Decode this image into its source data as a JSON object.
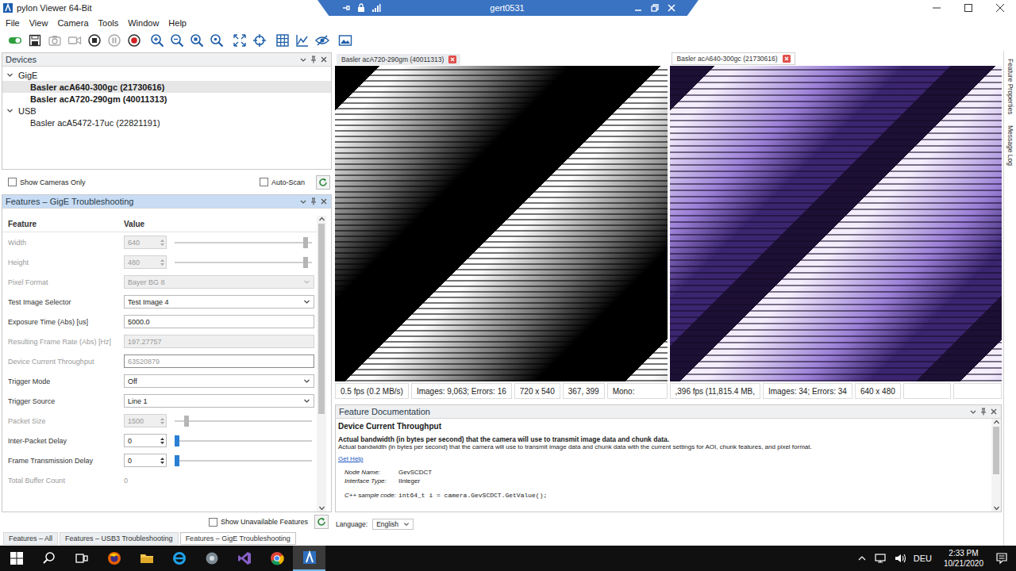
{
  "window": {
    "title": "pylon Viewer 64-Bit"
  },
  "remote_bar": {
    "title": "gert0531"
  },
  "menu": [
    "File",
    "View",
    "Camera",
    "Tools",
    "Window",
    "Help"
  ],
  "toolbar": [
    {
      "kind": "open",
      "disabled": false
    },
    {
      "kind": "save",
      "disabled": false
    },
    {
      "kind": "snapshot",
      "disabled": true
    },
    {
      "kind": "video",
      "disabled": true
    },
    {
      "kind": "stop",
      "disabled": false
    },
    {
      "kind": "pause",
      "disabled": true
    },
    {
      "kind": "record",
      "disabled": false
    },
    {
      "kind": "zoom-in",
      "disabled": false
    },
    {
      "kind": "zoom-out",
      "disabled": false
    },
    {
      "kind": "zoom-reset",
      "disabled": false
    },
    {
      "kind": "zoom-fit",
      "disabled": false
    },
    {
      "kind": "fit-window",
      "disabled": false
    },
    {
      "kind": "crosshair",
      "disabled": false
    },
    {
      "kind": "grid",
      "disabled": false
    },
    {
      "kind": "histogram",
      "disabled": false
    },
    {
      "kind": "hide",
      "disabled": false
    },
    {
      "kind": "image",
      "disabled": false
    }
  ],
  "devices": {
    "title": "Devices",
    "groups": [
      {
        "label": "GigE",
        "expanded": true,
        "items": [
          {
            "label": "Basler acA640-300gc (21730616)",
            "bold": true,
            "selected": true
          },
          {
            "label": "Basler acA720-290gm (40011313)",
            "bold": true,
            "selected": false
          }
        ]
      },
      {
        "label": "USB",
        "expanded": true,
        "items": [
          {
            "label": "Basler acA5472-17uc (22821191)",
            "bold": false,
            "selected": false
          }
        ]
      }
    ]
  },
  "show_cameras_only": {
    "label": "Show Cameras Only",
    "checked": false
  },
  "auto_scan": {
    "label": "Auto-Scan",
    "checked": false
  },
  "features": {
    "title": "Features – GigE Troubleshooting",
    "columns": [
      "Feature",
      "Value"
    ],
    "rows": [
      {
        "label": "Width",
        "value": "640",
        "kind": "spin-slider",
        "disabled": true,
        "selected": false,
        "level": 0.97
      },
      {
        "label": "Height",
        "value": "480",
        "kind": "spin-slider",
        "disabled": true,
        "selected": false,
        "level": 0.97
      },
      {
        "label": "Pixel Format",
        "value": "Bayer BG 8",
        "kind": "dropdown",
        "disabled": true,
        "selected": false
      },
      {
        "label": "Test Image Selector",
        "value": "Test Image 4",
        "kind": "dropdown",
        "disabled": false,
        "selected": false
      },
      {
        "label": "Exposure Time (Abs) [us]",
        "value": "5000.0",
        "kind": "text",
        "disabled": false,
        "selected": false
      },
      {
        "label": "Resulting Frame Rate (Abs) [Hz]",
        "value": "197.27757",
        "kind": "text",
        "disabled": true,
        "selected": false
      },
      {
        "label": "Device Current Throughput",
        "value": "63520879",
        "kind": "text",
        "disabled": true,
        "selected": true
      },
      {
        "label": "Trigger Mode",
        "value": "Off",
        "kind": "dropdown",
        "disabled": false,
        "selected": false
      },
      {
        "label": "Trigger Source",
        "value": "Line 1",
        "kind": "dropdown",
        "disabled": false,
        "selected": false
      },
      {
        "label": "Packet Size",
        "value": "1500",
        "kind": "spin-slider",
        "disabled": true,
        "selected": false,
        "level": 0.07
      },
      {
        "label": "Inter-Packet Delay",
        "value": "0",
        "kind": "spin-slider",
        "disabled": false,
        "selected": false,
        "level": 0
      },
      {
        "label": "Frame Transmission Delay",
        "value": "0",
        "kind": "spin-slider",
        "disabled": false,
        "selected": false,
        "level": 0
      },
      {
        "label": "Total Buffer Count",
        "value": "0",
        "kind": "plain",
        "disabled": true,
        "selected": false
      }
    ]
  },
  "show_unavailable": {
    "label": "Show Unavailable Features",
    "checked": false
  },
  "bottom_tabs": [
    {
      "label": "Features – All",
      "selected": false
    },
    {
      "label": "Features – USB3 Troubleshooting",
      "selected": false
    },
    {
      "label": "Features – GigE Troubleshooting",
      "selected": true
    }
  ],
  "viewers": [
    {
      "tab": "Basler acA720-290gm (40011313)",
      "selected": false,
      "kind": "mono",
      "status": [
        "0.5 fps (0.2 MB/s)",
        "Images: 9,063; Errors: 16",
        "720 x 540",
        "367, 399",
        "Mono:"
      ]
    },
    {
      "tab": "Basler acA640-300gc (21730616)",
      "selected": true,
      "kind": "color",
      "status": [
        ",396 fps (11,815.4 MB,",
        "Images: 34; Errors: 34",
        "640 x 480",
        "",
        ""
      ]
    }
  ],
  "documentation": {
    "title": "Feature Documentation",
    "heading": "Device Current Throughput",
    "summary": "Actual bandwidth (in bytes per second) that the camera will use to transmit image data and chunk data.",
    "description": "Actual bandwidth (in bytes per second) that the camera will use to transmit image data and chunk data with the current settings for AOI, chunk features, and pixel format.",
    "link": "Get Help",
    "fields": [
      {
        "label": "Node Name:",
        "value": "GevSCDCT"
      },
      {
        "label": "Interface Type:",
        "value": "IInteger"
      }
    ],
    "code_label": "C++ sample code:",
    "code": "int64_t i = camera.GevSCDCT.GetValue();"
  },
  "language": {
    "label": "Language:",
    "value": "English"
  },
  "side_tabs": [
    "Feature Properties",
    "Message Log"
  ],
  "taskbar": {
    "apps": [
      {
        "kind": "start",
        "selected": false
      },
      {
        "kind": "search",
        "selected": false
      },
      {
        "kind": "task-view",
        "selected": false
      },
      {
        "kind": "firefox",
        "selected": false
      },
      {
        "kind": "explorer",
        "selected": false
      },
      {
        "kind": "ie",
        "selected": false
      },
      {
        "kind": "app",
        "selected": false
      },
      {
        "kind": "visual-studio",
        "selected": false
      },
      {
        "kind": "chrome",
        "selected": false
      },
      {
        "kind": "pylon",
        "selected": true
      }
    ],
    "language": "DEU",
    "time": "2:33 PM",
    "date": "10/21/2020"
  }
}
